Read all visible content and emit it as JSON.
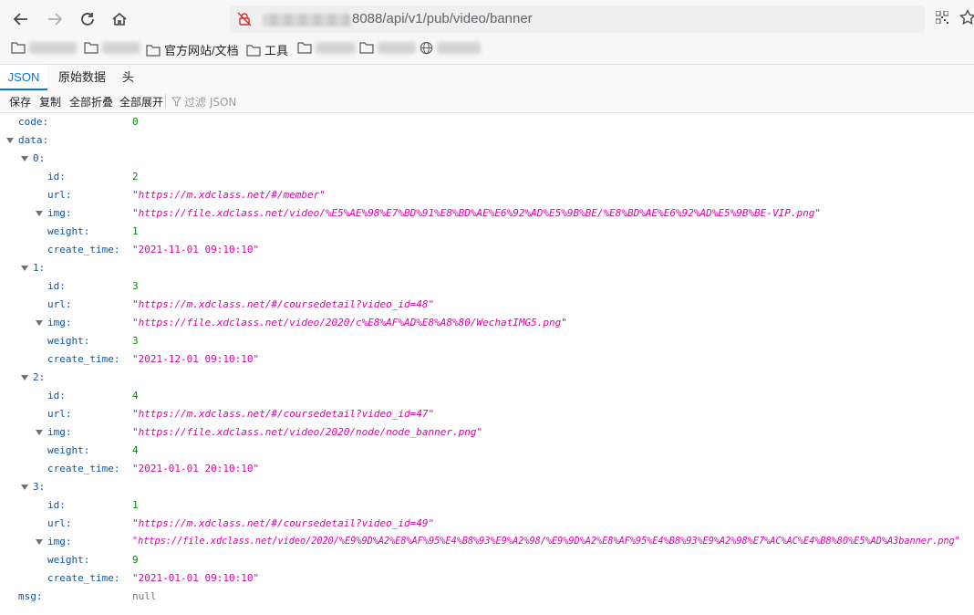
{
  "browser": {
    "url_suffix": "8088/api/v1/pub/video/banner",
    "bookmarks": [
      "官方网站/文档",
      "工具"
    ]
  },
  "tabs": [
    "JSON",
    "原始数据",
    "头"
  ],
  "toolbar": {
    "save": "保存",
    "copy": "复制",
    "collapse_all": "全部折叠",
    "expand_all": "全部展开",
    "filter_placeholder": "过滤 JSON"
  },
  "json": {
    "code_key": "code:",
    "code_val": "0",
    "data_key": "data:",
    "msg_key": "msg:",
    "msg_val": "null",
    "labels": {
      "id": "id:",
      "url": "url:",
      "img": "img:",
      "weight": "weight:",
      "create_time": "create_time:"
    },
    "items": [
      {
        "idx": "0:",
        "id": "2",
        "url": "\"https://m.xdclass.net/#/member\"",
        "img": "\"https://file.xdclass.net/video/%E5%AE%98%E7%BD%91%E8%BD%AE%E6%92%AD%E5%9B%BE/%E8%BD%AE%E6%92%AD%E5%9B%BE-VIP.png\"",
        "weight": "1",
        "create_time": "\"2021-11-01 09:10:10\""
      },
      {
        "idx": "1:",
        "id": "3",
        "url": "\"https://m.xdclass.net/#/coursedetail?video_id=48\"",
        "img": "\"https://file.xdclass.net/video/2020/c%E8%AF%AD%E8%A8%80/WechatIMG5.png\"",
        "weight": "3",
        "create_time": "\"2021-12-01 09:10:10\""
      },
      {
        "idx": "2:",
        "id": "4",
        "url": "\"https://m.xdclass.net/#/coursedetail?video_id=47\"",
        "img": "\"https://file.xdclass.net/video/2020/node/node_banner.png\"",
        "weight": "4",
        "create_time": "\"2021-01-01 20:10:10\""
      },
      {
        "idx": "3:",
        "id": "1",
        "url": "\"https://m.xdclass.net/#/coursedetail?video_id=49\"",
        "img": "\"https://file.xdclass.net/video/2020/%E9%9D%A2%E8%AF%95%E4%B8%93%E9%A2%98/%E9%9D%A2%E8%AF%95%E4%B8%93%E9%A2%98%E7%AC%AC%E4%B8%80%E5%AD%A3banner.png\"",
        "weight": "9",
        "create_time": "\"2021-01-01 09:10:10\""
      }
    ]
  }
}
